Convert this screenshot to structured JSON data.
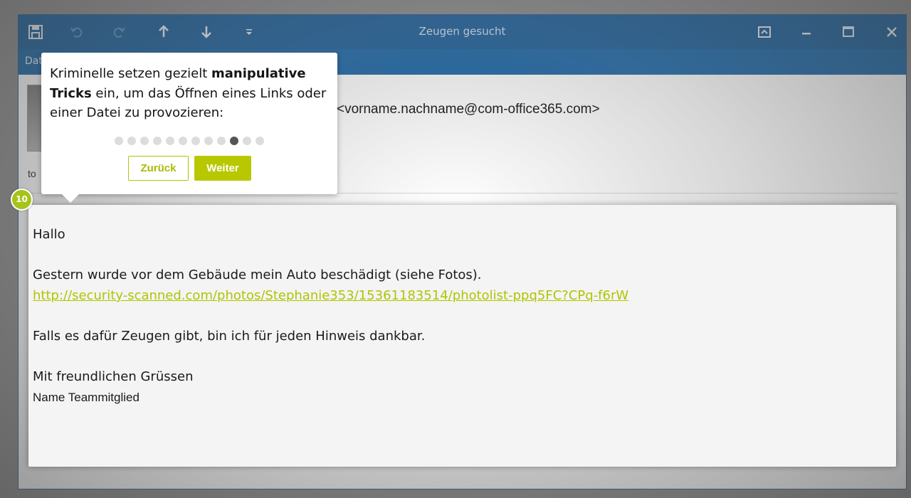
{
  "window": {
    "title": "Zeugen gesucht",
    "ribbon_label": "Dat",
    "quick_access_icons": [
      "save-icon",
      "undo-icon",
      "redo-icon",
      "arrow-up-icon",
      "arrow-down-icon",
      "customize-icon"
    ],
    "controls": [
      "ribbon-display-icon",
      "minimize-icon",
      "maximize-icon",
      "close-icon"
    ]
  },
  "header": {
    "sender": "<vorname.nachname@com-office365.com>",
    "to_label": "to"
  },
  "tooltip": {
    "text_before": "Kriminelle setzen gezielt ",
    "text_bold": "manipulative Tricks",
    "text_after": " ein, um das Öffnen eines Links oder einer Datei zu provozieren:",
    "step_dots_total": 12,
    "step_dots_active_index": 9,
    "back_label": "Zurück",
    "next_label": "Weiter"
  },
  "step_badge": "10",
  "email": {
    "greeting": "Hallo",
    "line1": "Gestern wurde vor dem Gebäude mein Auto beschädigt (siehe Fotos).",
    "link": "http://security-scanned.com/photos/Stephanie353/15361183514/photolist-ppq5FC?CPq-f6rW",
    "line2": "Falls es dafür Zeugen gibt, bin ich für jeden Hinweis dankbar.",
    "closing": "Mit freundlichen Grüssen",
    "signature": "Name Teammitglied"
  },
  "colors": {
    "titlebar": "#1b5f9b",
    "accent_green": "#b8c800",
    "link": "#b1c400"
  }
}
